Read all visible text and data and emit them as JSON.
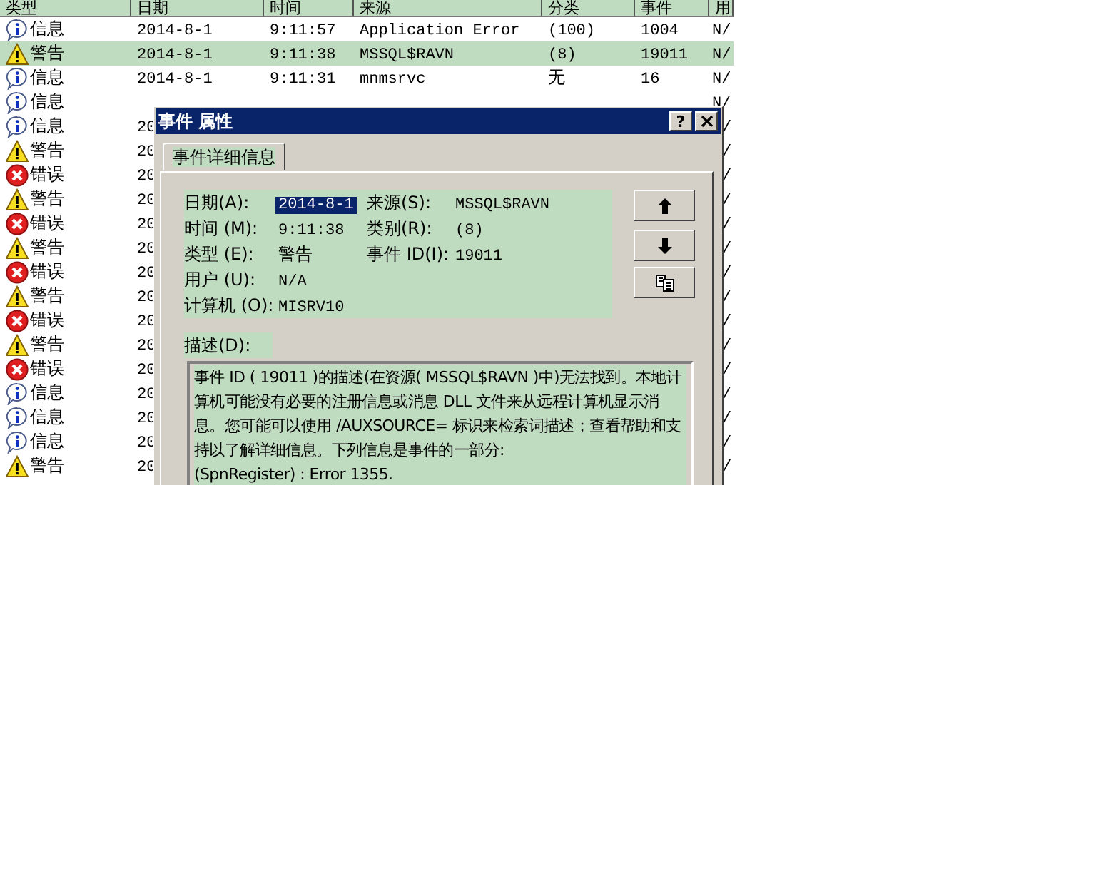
{
  "event_list": {
    "columns": [
      "类型",
      "日期",
      "时间",
      "来源",
      "分类",
      "事件",
      "用"
    ],
    "rows": [
      {
        "kind": "info",
        "type": "信息",
        "date": "2014-8-1",
        "time": "9:11:57",
        "source": "Application Error",
        "category": "(100)",
        "event": "1004",
        "user": "N/",
        "selected": false
      },
      {
        "kind": "warning",
        "type": "警告",
        "date": "2014-8-1",
        "time": "9:11:38",
        "source": "MSSQL$RAVN",
        "category": "(8)",
        "event": "19011",
        "user": "N/",
        "selected": true
      },
      {
        "kind": "info",
        "type": "信息",
        "date": "2014-8-1",
        "time": "9:11:31",
        "source": "mnmsrvc",
        "category": "无",
        "event": "16",
        "user": "N/",
        "selected": false
      },
      {
        "kind": "info",
        "type": "信息",
        "user": "N/",
        "selected": false
      },
      {
        "kind": "info",
        "type": "信息",
        "date": "20",
        "user": "/",
        "selected": false
      },
      {
        "kind": "warning",
        "type": "警告",
        "date": "20",
        "user": "/",
        "selected": false
      },
      {
        "kind": "error",
        "type": "错误",
        "date": "20",
        "user": "/",
        "selected": false
      },
      {
        "kind": "warning",
        "type": "警告",
        "date": "20",
        "user": "/",
        "selected": false
      },
      {
        "kind": "error",
        "type": "错误",
        "date": "20",
        "user": "/",
        "selected": false
      },
      {
        "kind": "warning",
        "type": "警告",
        "date": "20",
        "user": "/",
        "selected": false
      },
      {
        "kind": "error",
        "type": "错误",
        "date": "20",
        "user": "/",
        "selected": false
      },
      {
        "kind": "warning",
        "type": "警告",
        "date": "20",
        "user": "/",
        "selected": false
      },
      {
        "kind": "error",
        "type": "错误",
        "date": "20",
        "user": "/",
        "selected": false
      },
      {
        "kind": "warning",
        "type": "警告",
        "date": "20",
        "user": "/",
        "selected": false
      },
      {
        "kind": "error",
        "type": "错误",
        "date": "20",
        "user": "/",
        "selected": false
      },
      {
        "kind": "info",
        "type": "信息",
        "date": "20",
        "user": "/",
        "selected": false
      },
      {
        "kind": "info",
        "type": "信息",
        "date": "20",
        "user": "/",
        "selected": false
      },
      {
        "kind": "info",
        "type": "信息",
        "date": "20",
        "user": "/",
        "selected": false
      },
      {
        "kind": "warning",
        "type": "警告",
        "date": "20",
        "user": "/",
        "selected": false
      }
    ]
  },
  "dialog": {
    "title": "事件 属性",
    "help_button": "?",
    "tabs": [
      {
        "label": "事件详细信息",
        "selected": true
      }
    ],
    "field_rows": [
      [
        {
          "label": "日期(A):",
          "value": "2014-8-1",
          "selected": true
        },
        {
          "label": "来源(S):",
          "value": "MSSQL$RAVN",
          "selected": false
        }
      ],
      [
        {
          "label": "时间 (M):",
          "value": "9:11:38",
          "selected": false
        },
        {
          "label": "类别(R):",
          "value": "(8)",
          "selected": false
        }
      ],
      [
        {
          "label": "类型 (E):",
          "value": "警告",
          "selected": false
        },
        {
          "label": "事件 ID(I):",
          "value": "19011",
          "selected": false
        }
      ],
      [
        {
          "label": "用户 (U):",
          "value": "N/A",
          "selected": false
        }
      ],
      [
        {
          "label": "计算机 (O):",
          "value": "MISRV10",
          "selected": false
        }
      ]
    ],
    "description_label": "描述(D):",
    "description": "事件 ID ( 19011 )的描述(在资源( MSSQL$RAVN )中)无法找到。本地计算机可能没有必要的注册信息或消息 DLL 文件来从远程计算机显示消息。您可能可以使用 /AUXSOURCE= 标识来检索词描述；查看帮助和支持以了解详细信息。下列信息是事件的一部分:\n(SpnRegister) : Error 1355."
  }
}
